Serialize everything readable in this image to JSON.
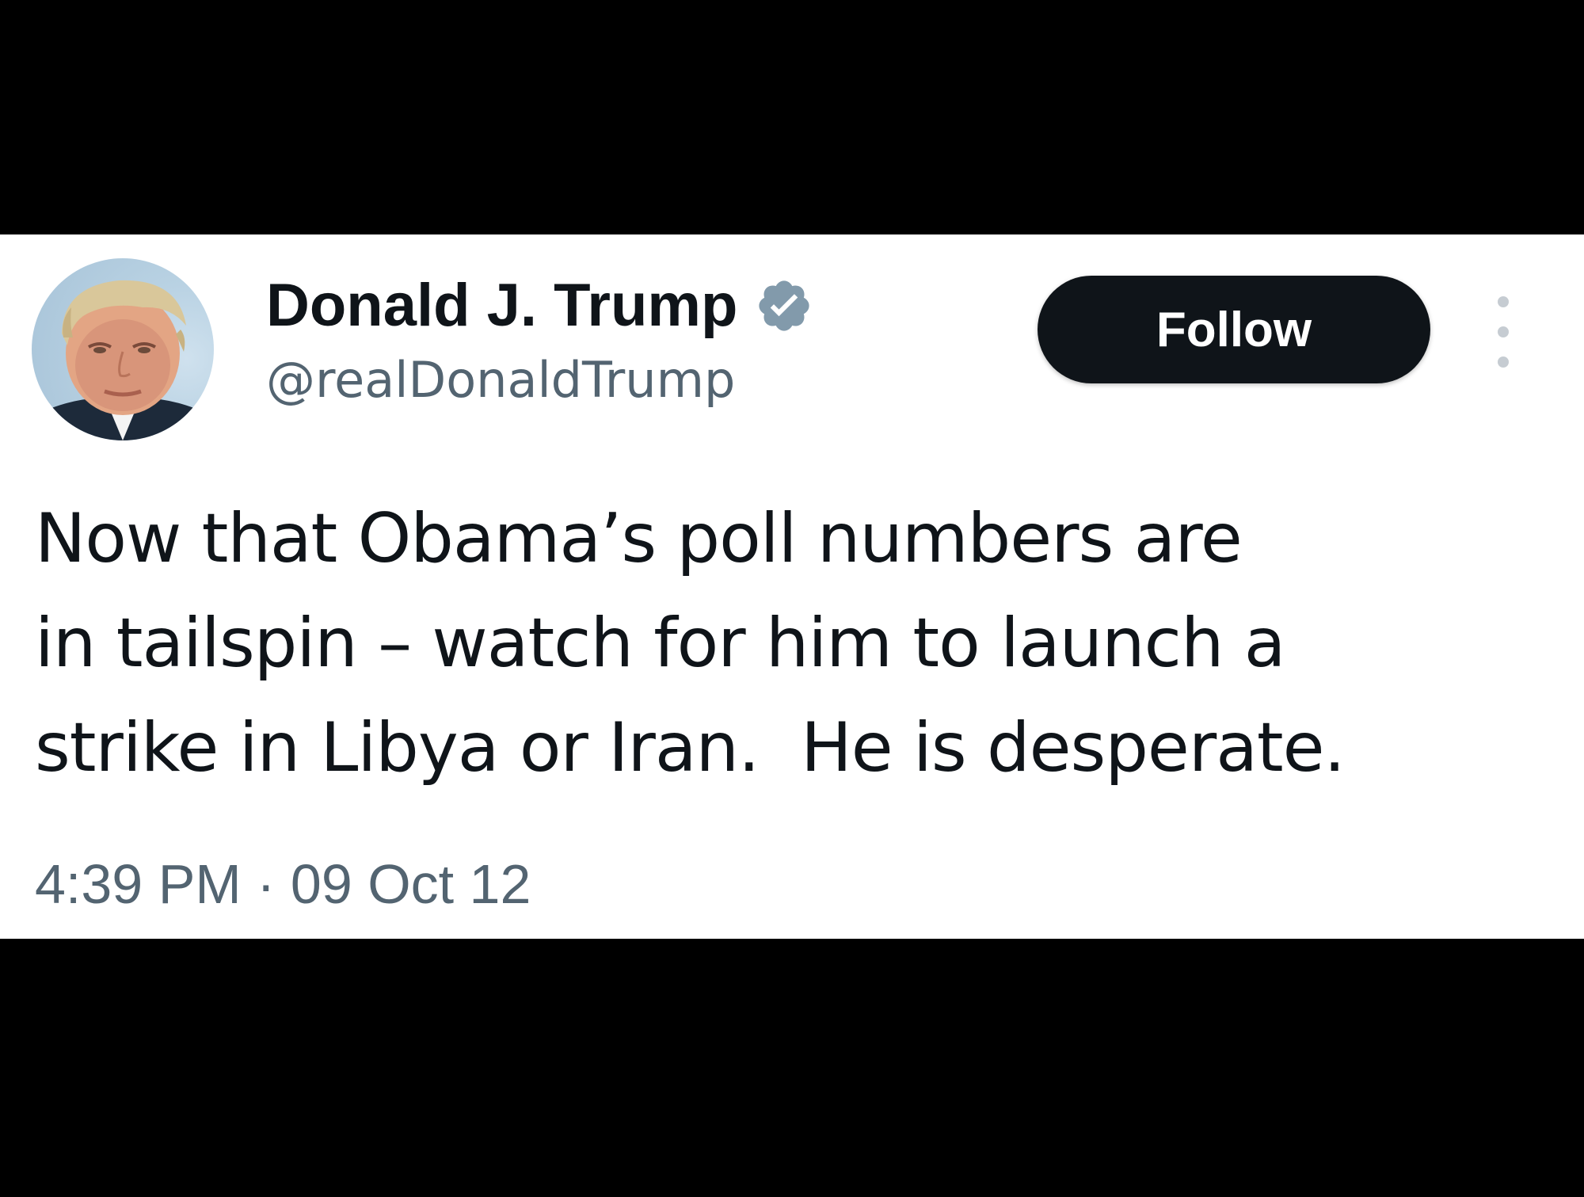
{
  "author": {
    "display_name": "Donald J. Trump",
    "handle": "@realDonaldTrump",
    "verified": true
  },
  "actions": {
    "follow_label": "Follow"
  },
  "tweet": {
    "lines": [
      "Now that Obama’s poll numbers are",
      "in tailspin – watch for him to launch a",
      "strike in Libya or Iran.  He is desperate."
    ],
    "timestamp": "4:39 PM · 09 Oct 12"
  },
  "colors": {
    "page_background": "#000000",
    "card_background": "#ffffff",
    "primary_text": "#0f1419",
    "secondary_text": "#536471",
    "follow_button": "#0f1419",
    "verified_badge": "#829aab"
  },
  "icons": {
    "verified": "verified-badge-icon",
    "more": "more-options-icon"
  }
}
